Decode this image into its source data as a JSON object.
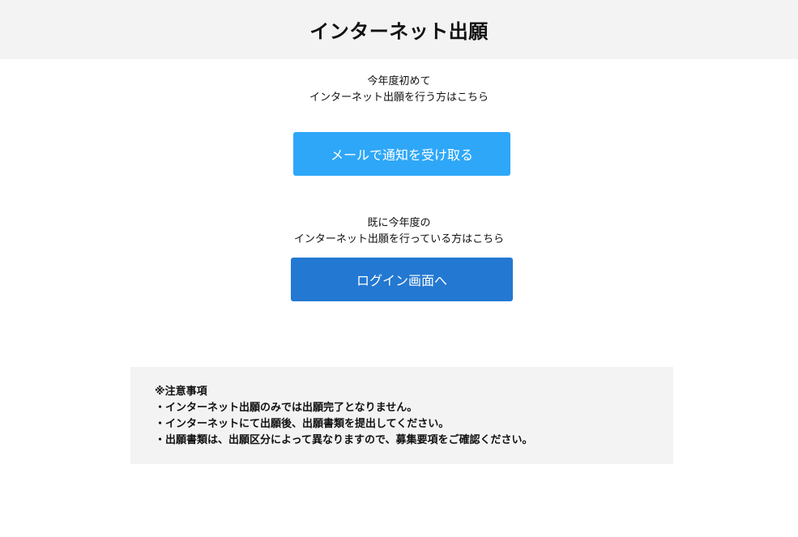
{
  "header": {
    "title": "インターネット出願"
  },
  "new_applicant": {
    "line1": "今年度初めて",
    "line2": "インターネット出願を行う方はこちら",
    "button_label": "メールで通知を受け取る"
  },
  "existing_applicant": {
    "line1": "既に今年度の",
    "line2": "インターネット出願を行っている方はこちら",
    "button_label": "ログイン画面へ"
  },
  "notice": {
    "heading": "※注意事項",
    "items": [
      "・インターネット出願のみでは出願完了となりません。",
      "・インターネットにて出願後、出願書類を提出してください。",
      "・出願書類は、出願区分によって異なりますので、募集要項をご確認ください。"
    ]
  },
  "colors": {
    "header_bg": "#f3f3f3",
    "mail_button": "#2ea7f8",
    "login_button": "#2378d1",
    "notice_bg": "#f3f3f3"
  }
}
